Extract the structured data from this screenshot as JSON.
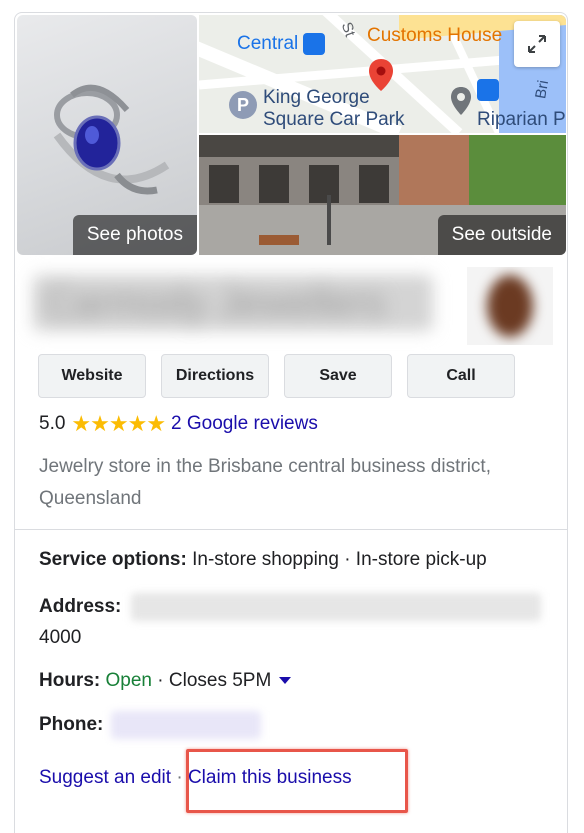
{
  "photos": {
    "see_photos_label": "See photos",
    "see_outside_label": "See outside",
    "map_labels": {
      "central": "Central",
      "customs_house": "Customs House",
      "king_george": "King George",
      "square_car_park": "Square Car Park",
      "riparian": "Riparian P",
      "street_st": "St",
      "street_bri": "Bri"
    }
  },
  "business": {
    "name_redacted": "Carmody Jewellers"
  },
  "actions": {
    "website": "Website",
    "directions": "Directions",
    "save": "Save",
    "call": "Call"
  },
  "rating": {
    "score": "5.0",
    "stars": "★★★★★",
    "reviews": "2 Google reviews"
  },
  "description": "Jewelry store in the Brisbane central business district, Queensland",
  "info": {
    "service_label": "Service options:",
    "service_value": "In-store shopping · In-store pick-up",
    "address_label": "Address:",
    "address_line2": "4000",
    "hours_label": "Hours:",
    "hours_status": "Open",
    "hours_detail": "· Closes 5PM",
    "phone_label": "Phone:"
  },
  "links": {
    "suggest_edit": "Suggest an edit",
    "separator": "·",
    "claim_business": "Claim this business"
  },
  "colors": {
    "link": "#1a0dab",
    "open": "#188038",
    "star": "#fbbc04",
    "highlight": "#e8564a"
  },
  "icons": {
    "expand": "expand-icon",
    "transit": "transit-icon",
    "parking": "parking-icon",
    "location_pin": "location-pin-icon",
    "caret": "caret-down-icon"
  }
}
